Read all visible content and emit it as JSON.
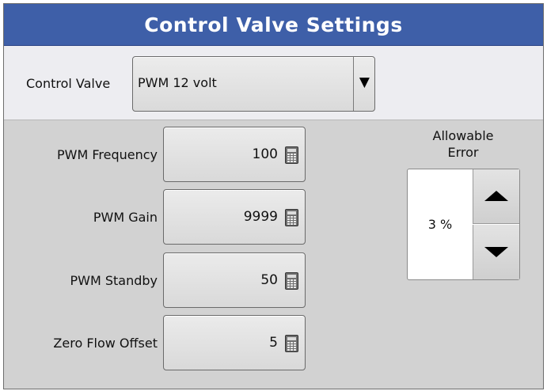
{
  "title": "Control Valve Settings",
  "control_valve": {
    "label": "Control Valve",
    "selected": "PWM 12 volt",
    "dropdown_icon": "triangle-down"
  },
  "fields": [
    {
      "label": "PWM Frequency",
      "value": "100"
    },
    {
      "label": "PWM Gain",
      "value": "9999"
    },
    {
      "label": "PWM Standby",
      "value": "50"
    },
    {
      "label": "Zero Flow Offset",
      "value": "5"
    }
  ],
  "keypad_icon": "calculator-icon",
  "allowable_error": {
    "label_line1": "Allowable",
    "label_line2": "Error",
    "value": "3 %",
    "up_icon": "triangle-up",
    "down_icon": "triangle-down"
  },
  "colors": {
    "title_bar": "#3e5fa8",
    "panel_bg": "#d2d2d2",
    "top_row_bg": "#ededf1"
  }
}
